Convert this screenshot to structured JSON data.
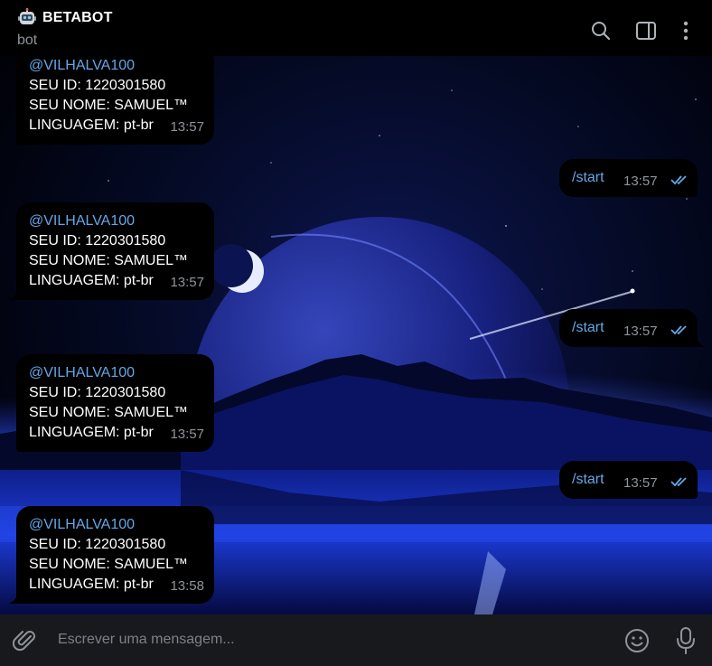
{
  "header": {
    "title": "BETABOT",
    "subtitle": "bot",
    "icons": [
      "robot-icon",
      "search-icon",
      "sidebar-toggle-icon",
      "more-vertical-icon"
    ]
  },
  "messages": {
    "incoming": [
      {
        "mention": "@VILHALVA100",
        "id_line": "SEU ID: 1220301580",
        "name_line": "SEU NOME: SAMUEL™",
        "lang_line": "LINGUAGEM: pt-br",
        "time": "13:57"
      },
      {
        "mention": "@VILHALVA100",
        "id_line": "SEU ID: 1220301580",
        "name_line": "SEU NOME: SAMUEL™",
        "lang_line": "LINGUAGEM: pt-br",
        "time": "13:57"
      },
      {
        "mention": "@VILHALVA100",
        "id_line": "SEU ID: 1220301580",
        "name_line": "SEU NOME: SAMUEL™",
        "lang_line": "LINGUAGEM: pt-br",
        "time": "13:57"
      },
      {
        "mention": "@VILHALVA100",
        "id_line": "SEU ID: 1220301580",
        "name_line": "SEU NOME: SAMUEL™",
        "lang_line": "LINGUAGEM: pt-br",
        "time": "13:58"
      }
    ],
    "outgoing": [
      {
        "text": "/start",
        "time": "13:57"
      },
      {
        "text": "/start",
        "time": "13:57"
      },
      {
        "text": "/start",
        "time": "13:57"
      }
    ]
  },
  "composer": {
    "placeholder": "Escrever uma mensagem...",
    "icons": [
      "attach-icon",
      "emoji-icon",
      "microphone-icon"
    ]
  },
  "colors": {
    "link": "#64a7e8",
    "time": "#8f949a",
    "bubble": "#000000",
    "composer_bg": "#17191d",
    "read_check": "#64a7e8"
  }
}
